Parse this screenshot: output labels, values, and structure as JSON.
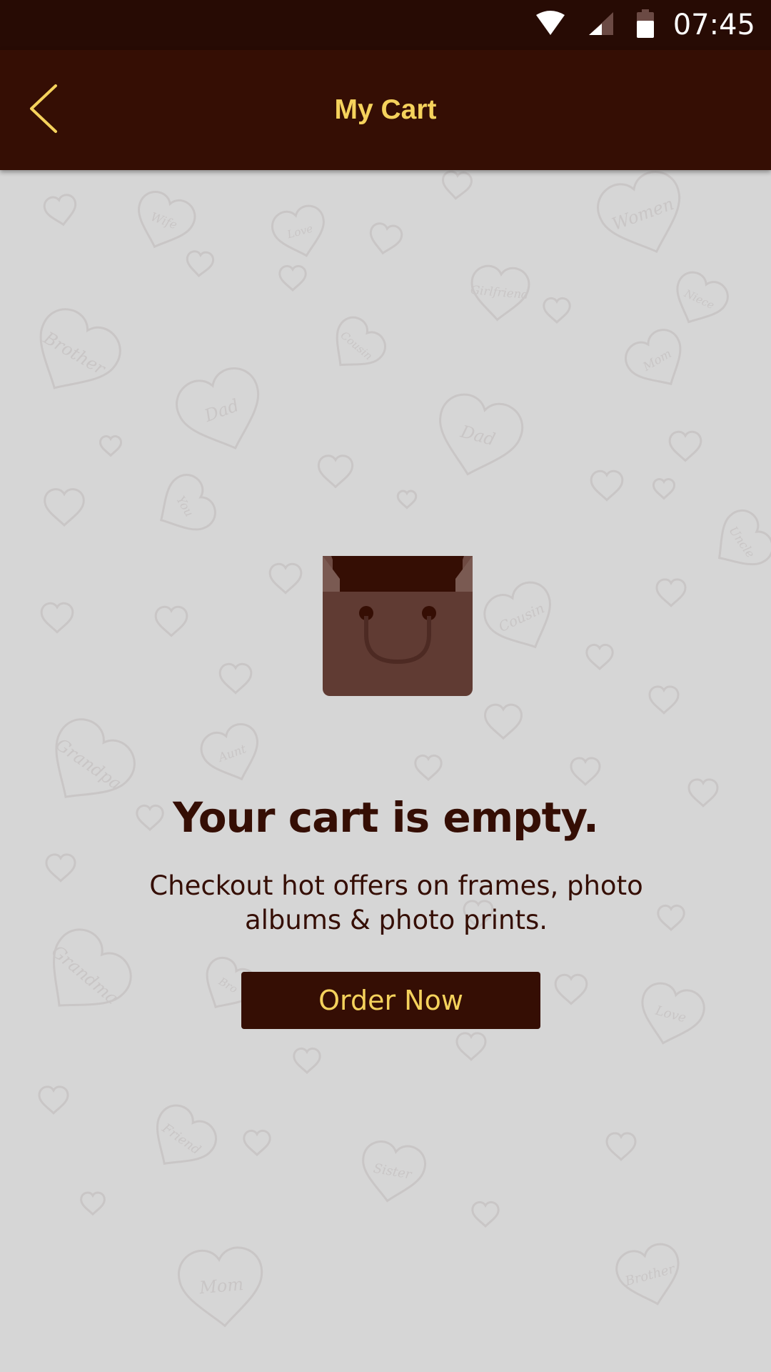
{
  "status_bar": {
    "time": "07:45",
    "icons": [
      "wifi-icon",
      "cellular-signal-icon",
      "battery-icon"
    ]
  },
  "app_bar": {
    "title": "My Cart",
    "back_icon": "chevron-left-icon"
  },
  "background_pattern_words": [
    "Wife",
    "Love",
    "Women",
    "Brother",
    "Cousin",
    "Girlfriend",
    "Niece",
    "Mom",
    "Dad",
    "Dad",
    "You",
    "Uncle",
    "Cousin",
    "Grandpa",
    "Aunt",
    "Grandma",
    "Bro",
    "Friend",
    "Sister",
    "Love",
    "Mom",
    "Brother"
  ],
  "empty_state": {
    "icon": "shopping-bag-icon",
    "title": "Your cart is empty.",
    "subtitle": "Checkout hot offers on frames, photo albums & photo prints.",
    "button_label": "Order Now"
  },
  "colors": {
    "status_bar_bg": "#270b04",
    "app_bar_bg": "#350e04",
    "accent_gold": "#f5d25c",
    "text_dark": "#350e04",
    "background": "#d6d6d6",
    "bag_body": "#603b33"
  }
}
